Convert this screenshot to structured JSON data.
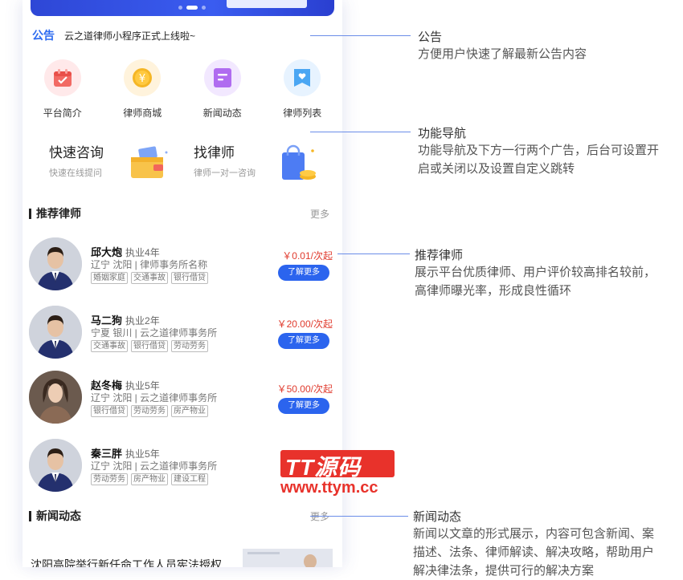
{
  "notice": {
    "tag": "公告",
    "text": "云之道律师小程序正式上线啦~"
  },
  "nav": [
    {
      "label": "平台简介",
      "icon": "calendar-icon",
      "bg": "#ffe9ea",
      "color": "#f26a64"
    },
    {
      "label": "律师商城",
      "icon": "coin-yen-icon",
      "bg": "#fff3dc",
      "color": "#f5b625"
    },
    {
      "label": "新闻动态",
      "icon": "news-document-icon",
      "bg": "#f2e8ff",
      "color": "#b06cf0"
    },
    {
      "label": "律师列表",
      "icon": "bookmark-heart-icon",
      "bg": "#e7f3ff",
      "color": "#4aa6f3"
    }
  ],
  "ads": [
    {
      "title": "快速咨询",
      "sub": "快速在线提问",
      "icon": "wallet-cards-icon"
    },
    {
      "title": "找律师",
      "sub": "律师一对一咨询",
      "icon": "shopping-bag-icon"
    }
  ],
  "recommend": {
    "title": "推荐律师",
    "more": "更多"
  },
  "lawyers": [
    {
      "name": "邱大炮",
      "years": "执业4年",
      "location": "辽宁 沈阳 | 律师事务所名称",
      "tags": [
        "婚姻家庭",
        "交通事故",
        "银行借贷"
      ],
      "price": "￥0.01/次起",
      "button": "了解更多",
      "avatar": "male"
    },
    {
      "name": "马二狗",
      "years": "执业2年",
      "location": "宁夏 银川 | 云之道律师事务所",
      "tags": [
        "交通事故",
        "银行借贷",
        "劳动劳务"
      ],
      "price": "￥20.00/次起",
      "button": "了解更多",
      "avatar": "male"
    },
    {
      "name": "赵冬梅",
      "years": "执业5年",
      "location": "辽宁 沈阳 | 云之道律师事务所",
      "tags": [
        "银行借贷",
        "劳动劳务",
        "房产物业"
      ],
      "price": "￥50.00/次起",
      "button": "了解更多",
      "avatar": "female"
    },
    {
      "name": "秦三胖",
      "years": "执业5年",
      "location": "辽宁 沈阳 | 云之道律师事务所",
      "tags": [
        "劳动劳务",
        "房产物业",
        "建设工程"
      ],
      "price": "",
      "button": "",
      "avatar": "male"
    }
  ],
  "news_section": {
    "title": "新闻动态",
    "more": "更多"
  },
  "news_item": {
    "title": "沈阳高院举行新任命工作人员宪法授权"
  },
  "annotations": [
    {
      "title": "公告",
      "desc": [
        "方便用户快速了解最新公告内容"
      ]
    },
    {
      "title": "功能导航",
      "desc": [
        "功能导航及下方一行两个广告，后台可设置开",
        "启或关闭以及设置自定义跳转"
      ]
    },
    {
      "title": "推荐律师",
      "desc": [
        "展示平台优质律师、用户评价较高排名较前，",
        "高律师曝光率，形成良性循环"
      ]
    },
    {
      "title": "新闻动态",
      "desc": [
        "新闻以文章的形式展示，内容可包含新闻、案",
        "描述、法条、律师解读、解决攻略，帮助用户",
        "解决律法条，提供可行的解决方案"
      ]
    }
  ],
  "watermark": {
    "top": "TT源码",
    "bottom": "www.ttym.cc"
  },
  "colors": {
    "accent": "#2b64ee",
    "price": "#e03b2e",
    "annotation_line": "#6b8de8"
  }
}
